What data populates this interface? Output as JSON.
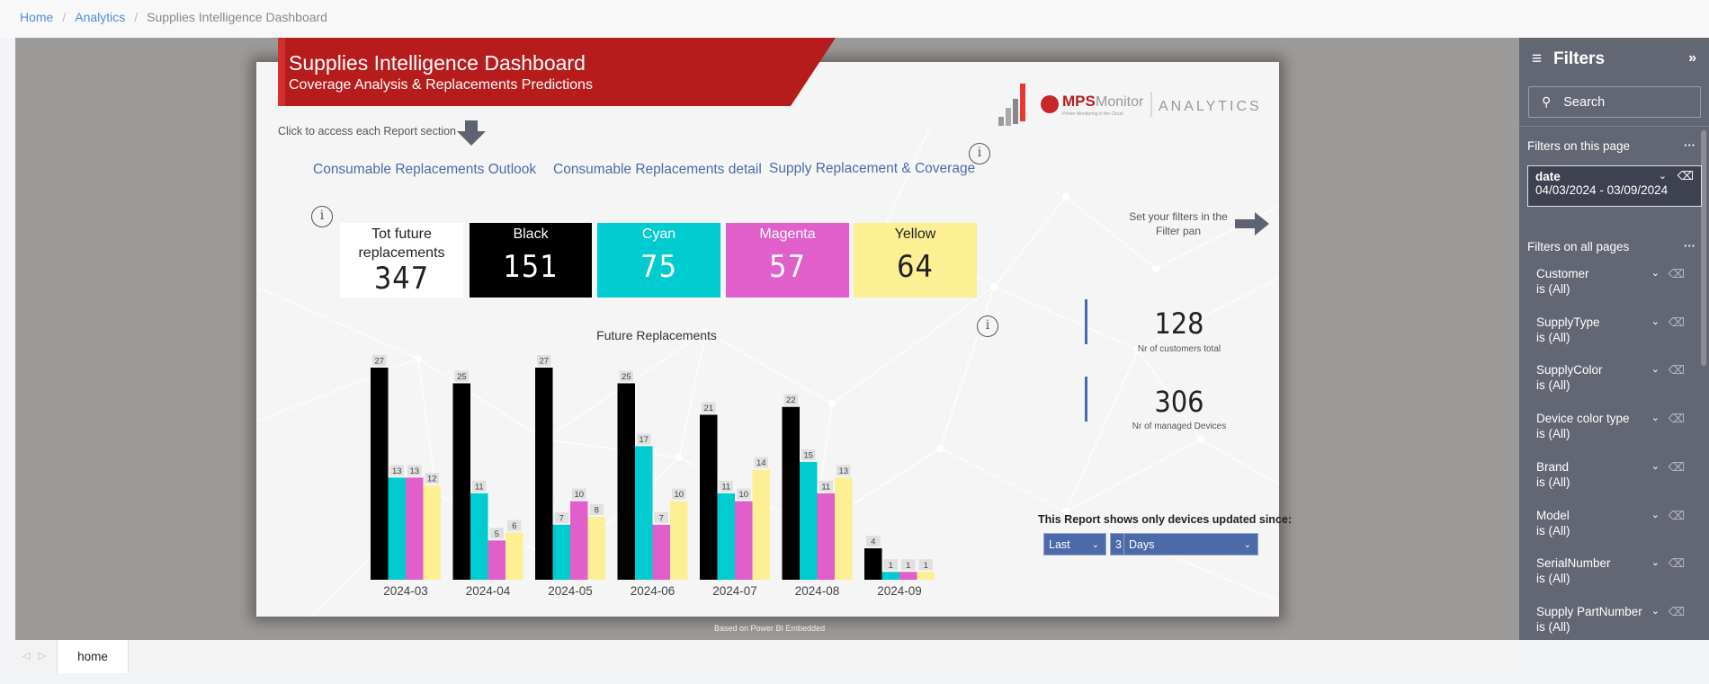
{
  "breadcrumb": {
    "items": [
      {
        "label": "Home"
      },
      {
        "label": "Analytics"
      }
    ],
    "current": "Supplies Intelligence Dashboard"
  },
  "banner": {
    "title": "Supplies Intelligence Dashboard",
    "subtitle": "Coverage Analysis & Replacements Predictions"
  },
  "logo": {
    "brand": "MPS Monitor",
    "tagline": "Printer Monitoring in the Cloud",
    "product": "ANALYTICS"
  },
  "hint": "Click to access each Report section",
  "nav_links": [
    "Consumable Replacements Outlook",
    "Consumable Replacements detail",
    "Supply Replacement & Coverage"
  ],
  "filter_hint": "Set your filters in the Filter pan",
  "kpis": [
    {
      "label": "Tot future replacements",
      "value": "347"
    },
    {
      "label": "Black",
      "value": "151"
    },
    {
      "label": "Cyan",
      "value": "75"
    },
    {
      "label": "Magenta",
      "value": "57"
    },
    {
      "label": "Yellow",
      "value": "64"
    }
  ],
  "colors": {
    "black": "#000000",
    "cyan": "#00cbce",
    "magenta": "#e05fcb",
    "yellow": "#fcef94",
    "accent_red": "#b71c1c",
    "link_blue": "#4d6aa8"
  },
  "chart_data": {
    "type": "bar",
    "title": "Future Replacements",
    "categories": [
      "2024-03",
      "2024-04",
      "2024-05",
      "2024-06",
      "2024-07",
      "2024-08",
      "2024-09"
    ],
    "series": [
      {
        "name": "Black",
        "values": [
          27,
          25,
          27,
          25,
          21,
          22,
          4
        ]
      },
      {
        "name": "Cyan",
        "values": [
          13,
          11,
          7,
          17,
          11,
          15,
          1
        ]
      },
      {
        "name": "Magenta",
        "values": [
          13,
          5,
          10,
          7,
          10,
          11,
          1
        ]
      },
      {
        "name": "Yellow",
        "values": [
          12,
          6,
          8,
          10,
          14,
          13,
          1
        ]
      }
    ],
    "xlabel": "",
    "ylabel": "",
    "ylim": [
      0,
      27
    ],
    "grid": false,
    "data_labels": true
  },
  "stats": [
    {
      "value": "128",
      "caption": "Nr of customers total"
    },
    {
      "value": "306",
      "caption": "Nr of managed Devices"
    }
  ],
  "updated_since": {
    "label": "This Report shows only devices updated since:",
    "mode": "Last",
    "amount": "3",
    "unit": "Days"
  },
  "footer_note": "Based on Power BI Embedded",
  "tabs": [
    {
      "label": "home"
    }
  ],
  "filters_pane": {
    "title": "Filters",
    "search_placeholder": "Search",
    "section_page": "Filters on this page",
    "page_filters": [
      {
        "name": "date",
        "value": "04/03/2024 - 03/09/2024"
      }
    ],
    "section_all": "Filters on all pages",
    "all_filters": [
      {
        "name": "Customer",
        "value": "is (All)"
      },
      {
        "name": "SupplyType",
        "value": "is (All)"
      },
      {
        "name": "SupplyColor",
        "value": "is (All)"
      },
      {
        "name": "Device color type",
        "value": "is (All)"
      },
      {
        "name": "Brand",
        "value": "is (All)"
      },
      {
        "name": "Model",
        "value": "is (All)"
      },
      {
        "name": "SerialNumber",
        "value": "is (All)"
      },
      {
        "name": "Supply PartNumber",
        "value": "is (All)"
      }
    ]
  }
}
